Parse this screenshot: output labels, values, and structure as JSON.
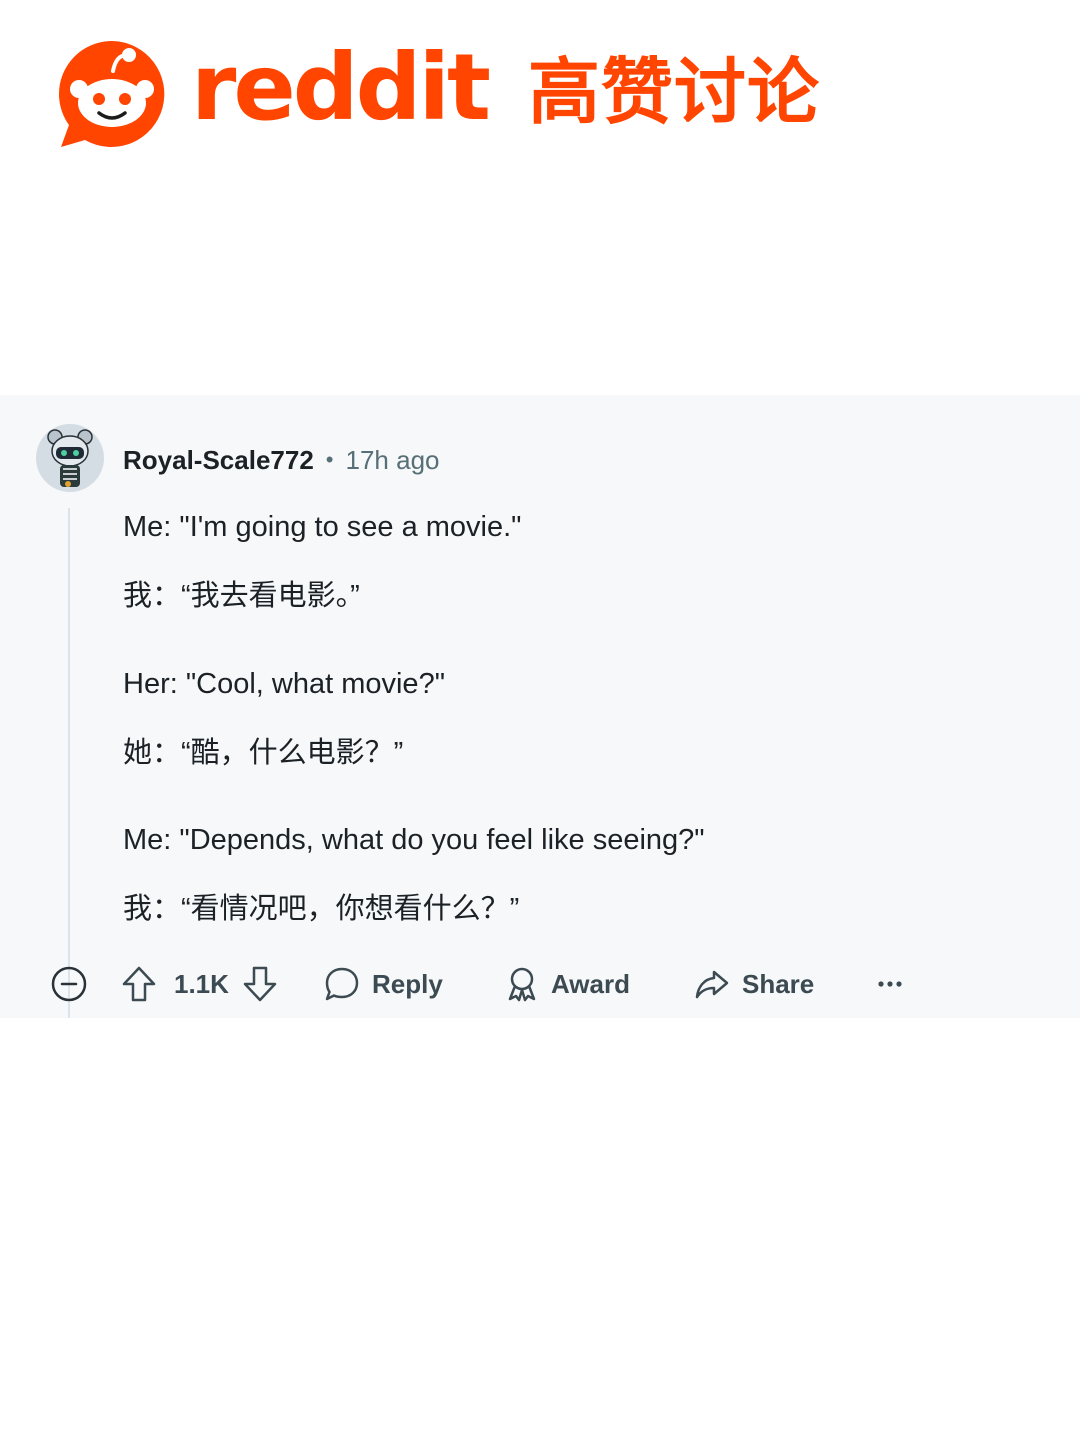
{
  "header": {
    "wordmark": "reddit",
    "tagline": "高赞讨论",
    "brand_color": "#ff4500"
  },
  "comment": {
    "username": "Royal-Scale772",
    "separator": "•",
    "time": "17h ago",
    "lines": [
      "Me: \"I'm going to see a movie.\"",
      "我：“我去看电影。”",
      "Her: \"Cool, what movie?\"",
      "她：“酷，什么电影？”",
      "Me: \"Depends, what do you feel like seeing?\"",
      "我：“看情况吧，你想看什么？”"
    ]
  },
  "actions": {
    "collapse_icon": "minus-circle-icon",
    "upvote_icon": "upvote-arrow-icon",
    "score": "1.1K",
    "downvote_icon": "downvote-arrow-icon",
    "reply": "Reply",
    "reply_icon": "speech-bubble-icon",
    "award": "Award",
    "award_icon": "award-ribbon-icon",
    "share": "Share",
    "share_icon": "share-arrow-icon",
    "more_icon": "more-dots-icon"
  }
}
